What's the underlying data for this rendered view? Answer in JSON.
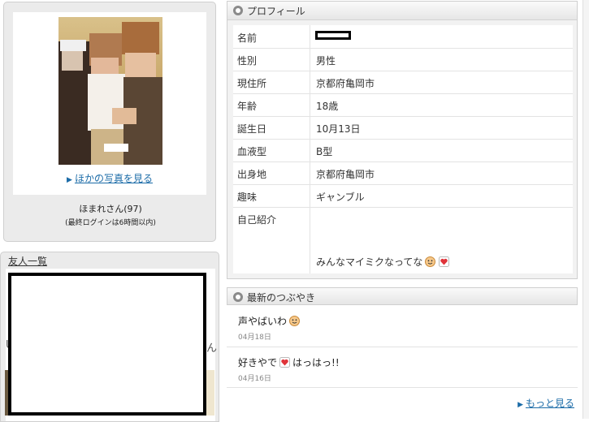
{
  "profile_card": {
    "more_photos_label": "ほかの写真を見る",
    "user_name": "ほまれさん(97)",
    "last_login": "(最終ログインは6時間以内)"
  },
  "friends": {
    "title": "友人一覧",
    "stray_left": "U",
    "stray_right": "ん"
  },
  "profile": {
    "title": "プロフィール",
    "rows": [
      {
        "label": "名前",
        "value": ""
      },
      {
        "label": "性別",
        "value": "男性"
      },
      {
        "label": "現住所",
        "value": "京都府亀岡市"
      },
      {
        "label": "年齢",
        "value": "18歳"
      },
      {
        "label": "誕生日",
        "value": "10月13日"
      },
      {
        "label": "血液型",
        "value": "B型"
      },
      {
        "label": "出身地",
        "value": "京都府亀岡市"
      },
      {
        "label": "趣味",
        "value": "ギャンブル"
      },
      {
        "label": "自己紹介",
        "value": "みんなマイミクなってな"
      }
    ]
  },
  "tweets": {
    "title": "最新のつぶやき",
    "items": [
      {
        "text": "声やばいわ",
        "date": "04月18日"
      },
      {
        "text_before": "好きやで",
        "text_after": "はっはっ!!",
        "date": "04月16日"
      }
    ],
    "more_label": "もっと見る"
  },
  "icons": {
    "smiley": "smiley-face-icon",
    "heart": "heart-icon",
    "arrow": "right-triangle-arrow-icon",
    "section": "circle-bullet-icon"
  }
}
